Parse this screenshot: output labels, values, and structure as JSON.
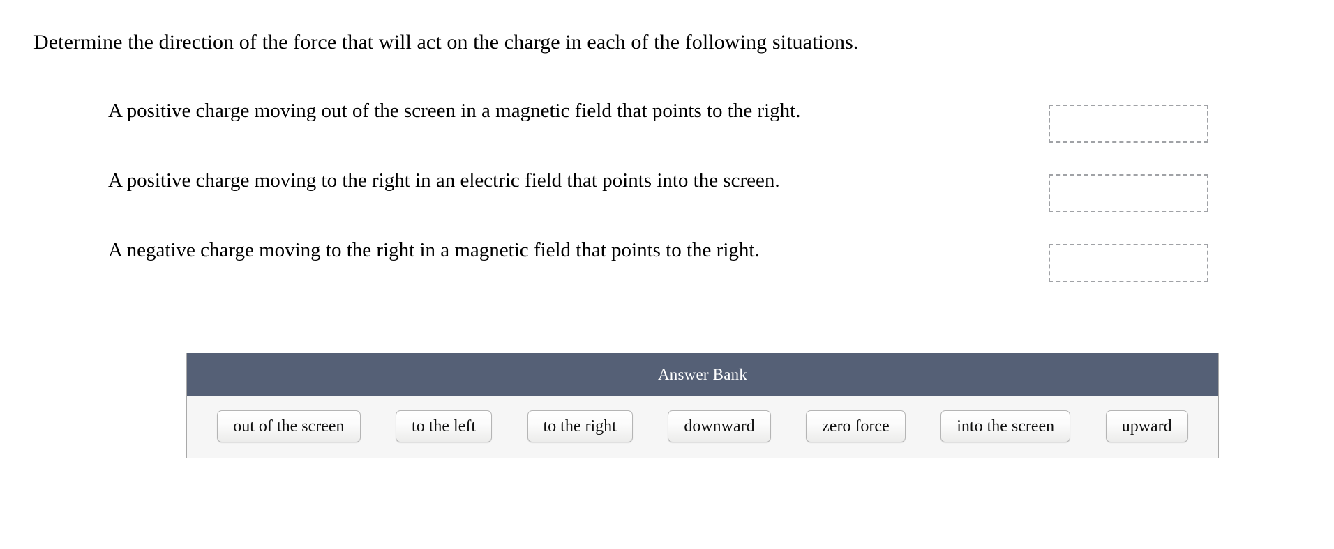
{
  "prompt": "Determine the direction of the force that will act on the charge in each of the following situations.",
  "rows": [
    {
      "text": "A positive charge moving out of the screen in a magnetic field that points to the right.",
      "answer": ""
    },
    {
      "text": "A positive charge moving to the right in an electric field that points into the screen.",
      "answer": ""
    },
    {
      "text": "A negative charge moving to the right in a magnetic field that points to the right.",
      "answer": ""
    }
  ],
  "answer_bank": {
    "title": "Answer Bank",
    "options": [
      "out of the screen",
      "to the left",
      "to the right",
      "downward",
      "zero force",
      "into the screen",
      "upward"
    ]
  },
  "colors": {
    "header_background": "#556076",
    "header_text": "#ffffff",
    "panel_background": "#f6f6f6",
    "panel_border": "#a9a9a9",
    "dropzone_border": "#a0a2a6",
    "chip_border": "#b5b5b5",
    "text": "#000000"
  }
}
